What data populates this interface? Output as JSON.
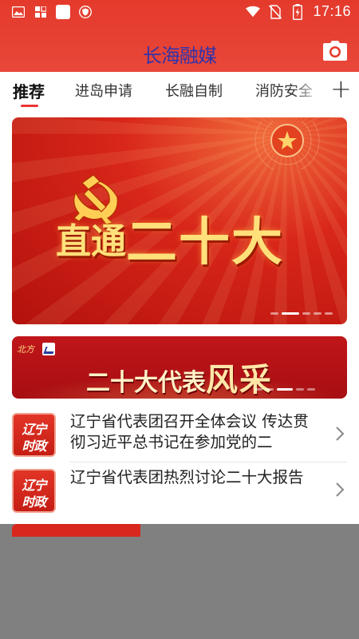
{
  "status_bar": {
    "time": "17:16",
    "left_icons": [
      "image-icon",
      "grid-icon",
      "square-icon",
      "shield-icon"
    ],
    "right_icons": [
      "wifi-icon",
      "no-sim-icon",
      "battery-charging-icon"
    ]
  },
  "app": {
    "logo_text": "长海融媒",
    "camera_icon": "camera-icon",
    "colors": {
      "header_red": "#e43a2c",
      "logo_blue": "#3433a8",
      "accent_red": "#e33333"
    }
  },
  "tabs": [
    {
      "label": "推荐",
      "active": true
    },
    {
      "label": "进岛申请",
      "active": false
    },
    {
      "label": "长融自制",
      "active": false
    },
    {
      "label": "消防安全",
      "active": false
    }
  ],
  "tabs_more_label": "+",
  "banner": {
    "title_main": "二十大",
    "title_prefix": "直通",
    "slide_count": 5,
    "active_slide": 2
  },
  "strip": {
    "badge": "北方",
    "title_main": "二十大代表",
    "title_accent": "风采",
    "slide_count": 5,
    "active_slide": 3
  },
  "news": [
    {
      "thumb_line1": "辽宁",
      "thumb_line2": "时政",
      "title": "辽宁省代表团召开全体会议 传达贯彻习近平总书记在参加党的二"
    },
    {
      "thumb_line1": "辽宁",
      "thumb_line2": "时政",
      "title": "辽宁省代表团热烈讨论二十大报告"
    }
  ]
}
